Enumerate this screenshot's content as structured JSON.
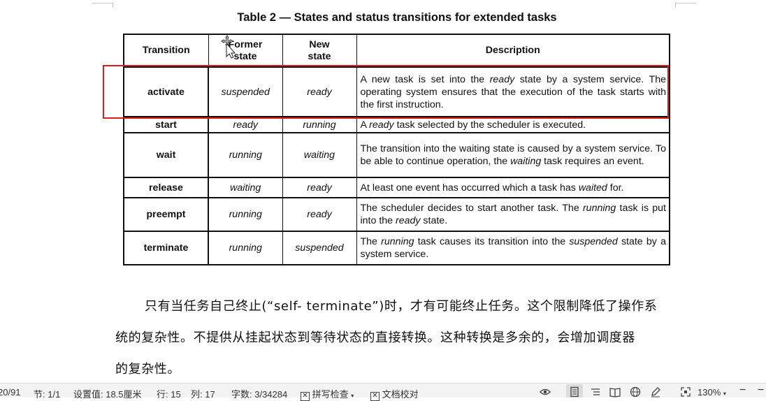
{
  "table": {
    "title": "Table 2 — States and status transitions for extended tasks",
    "headers": {
      "transition": "Transition",
      "former_line1": "Former",
      "former_line2": "state",
      "new_line1": "New",
      "new_line2": "state",
      "description": "Description"
    },
    "rows": [
      {
        "transition": "activate",
        "former": "suspended",
        "new": "ready",
        "desc": [
          {
            "t": "A new task is set into the "
          },
          {
            "t": "ready",
            "i": true
          },
          {
            "t": " state by a system service. The operating system ensures that the execution of the task starts with the first instruction."
          }
        ]
      },
      {
        "transition": "start",
        "former": "ready",
        "new": "running",
        "desc": [
          {
            "t": "A "
          },
          {
            "t": "ready",
            "i": true
          },
          {
            "t": " task selected by the scheduler is executed."
          }
        ]
      },
      {
        "transition": "wait",
        "former": "running",
        "new": "waiting",
        "desc": [
          {
            "t": "The transition into the waiting state is caused by a system service. To be able to continue operation, the "
          },
          {
            "t": "waiting",
            "i": true
          },
          {
            "t": " task requires an event."
          }
        ]
      },
      {
        "transition": "release",
        "former": "waiting",
        "new": "ready",
        "desc": [
          {
            "t": "At least one event has occurred which a task has "
          },
          {
            "t": "waited",
            "i": true
          },
          {
            "t": " for."
          }
        ]
      },
      {
        "transition": "preempt",
        "former": "running",
        "new": "ready",
        "desc": [
          {
            "t": "The scheduler decides to start another task. The "
          },
          {
            "t": "running",
            "i": true
          },
          {
            "t": " task is put into the "
          },
          {
            "t": "ready",
            "i": true
          },
          {
            "t": " state."
          }
        ]
      },
      {
        "transition": "terminate",
        "former": "running",
        "new": "suspended",
        "desc": [
          {
            "t": "The "
          },
          {
            "t": "running",
            "i": true
          },
          {
            "t": " task causes its transition into the "
          },
          {
            "t": "suspended",
            "i": true
          },
          {
            "t": " state by a system service."
          }
        ]
      }
    ]
  },
  "paragraph": {
    "line1": "只有当任务自己终止(“self- terminate”)时，才有可能终止任务。这个限制降低了操作系",
    "line2": "统的复杂性。不提供从挂起状态到等待状态的直接转换。这种转换是多余的，会增加调度器",
    "line3": "的复杂性。"
  },
  "statusbar": {
    "page": "20/91",
    "section": "节: 1/1",
    "setting": "设置值: 18.5厘米",
    "row": "行: 15",
    "col": "列: 17",
    "wordcount": "字数: 3/34284",
    "spellcheck": "拼写检查",
    "doccheck": "文档校对",
    "zoom": "130%"
  },
  "colors": {
    "highlight": "#e01c1c"
  },
  "icons": [
    "move-cursor-icon",
    "eye-icon",
    "page-view-icon",
    "outline-view-icon",
    "book-view-icon",
    "web-view-icon",
    "pen-icon",
    "fit-page-icon",
    "zoom-out-icon"
  ]
}
